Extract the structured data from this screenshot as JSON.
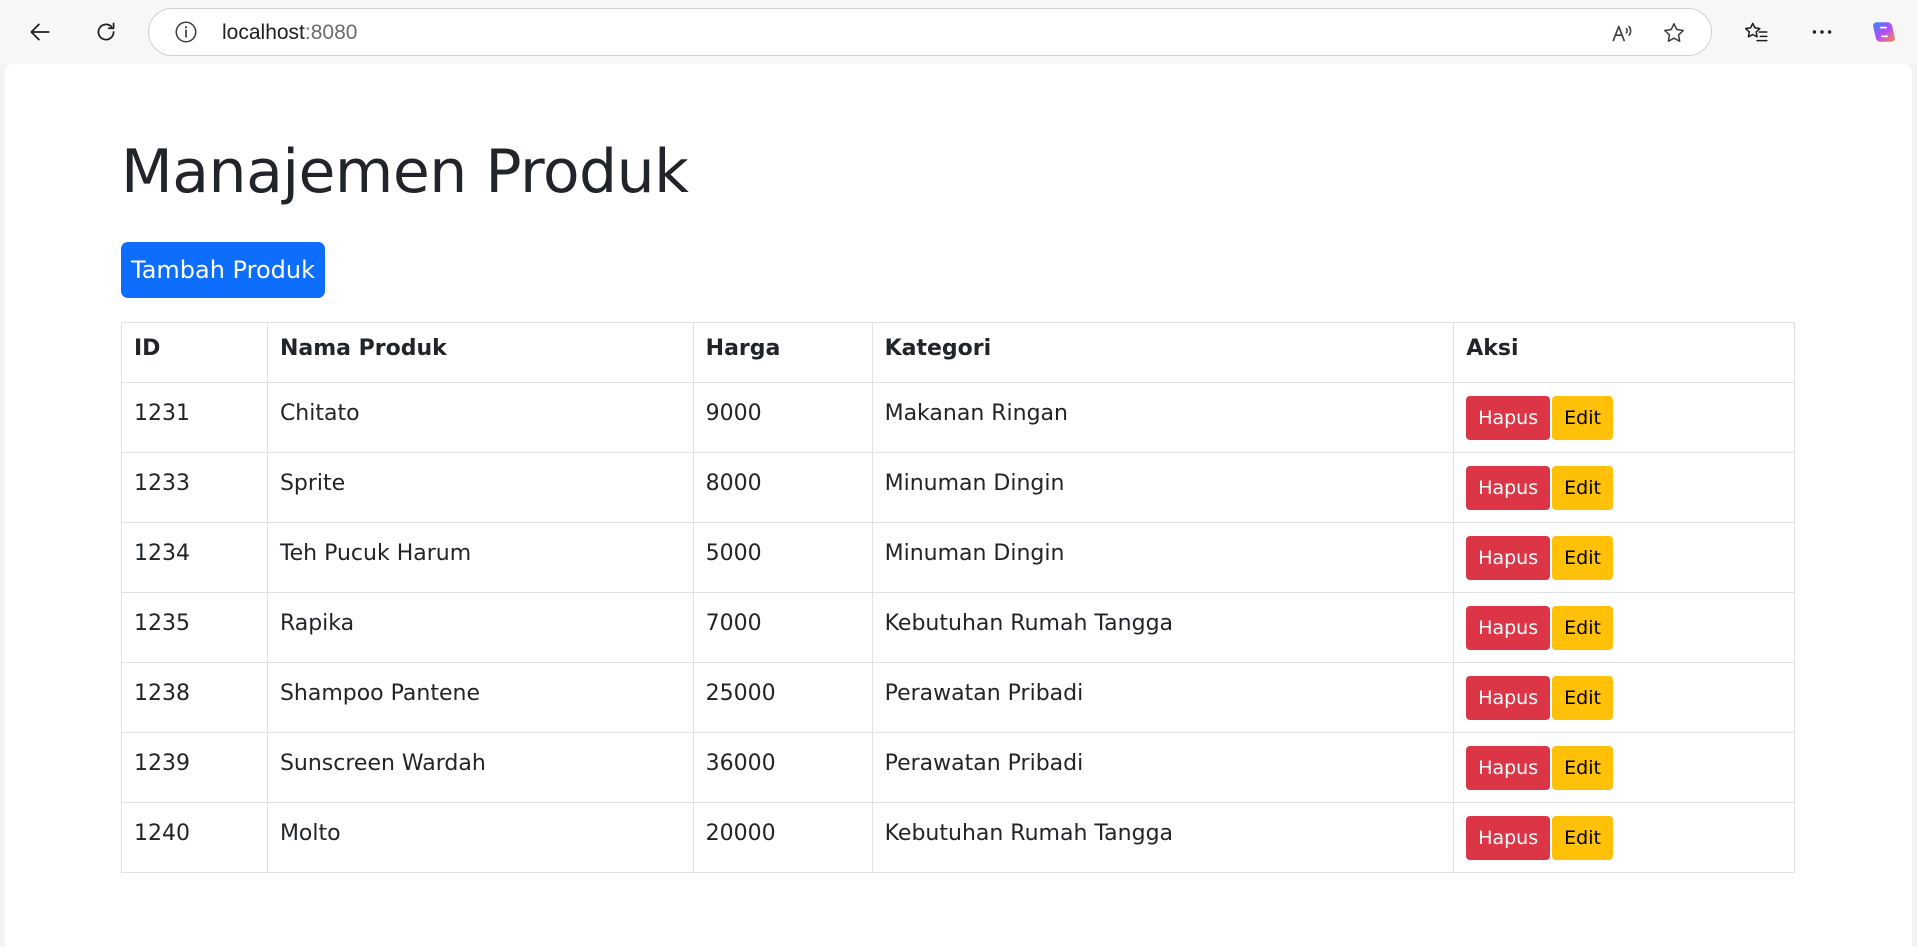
{
  "browser": {
    "url_host": "localhost",
    "url_port": ":8080"
  },
  "page": {
    "title": "Manajemen Produk",
    "add_button_label": "Tambah Produk"
  },
  "table": {
    "headers": {
      "id": "ID",
      "name": "Nama Produk",
      "price": "Harga",
      "category": "Kategori",
      "action": "Aksi"
    },
    "delete_label": "Hapus",
    "edit_label": "Edit",
    "rows": [
      {
        "id": "1231",
        "name": "Chitato",
        "price": "9000",
        "category": "Makanan Ringan"
      },
      {
        "id": "1233",
        "name": "Sprite",
        "price": "8000",
        "category": "Minuman Dingin"
      },
      {
        "id": "1234",
        "name": "Teh Pucuk Harum",
        "price": "5000",
        "category": "Minuman Dingin"
      },
      {
        "id": "1235",
        "name": "Rapika",
        "price": "7000",
        "category": "Kebutuhan Rumah Tangga"
      },
      {
        "id": "1238",
        "name": "Shampoo Pantene",
        "price": "25000",
        "category": "Perawatan Pribadi"
      },
      {
        "id": "1239",
        "name": "Sunscreen Wardah",
        "price": "36000",
        "category": "Perawatan Pribadi"
      },
      {
        "id": "1240",
        "name": "Molto",
        "price": "20000",
        "category": "Kebutuhan Rumah Tangga"
      }
    ]
  },
  "colors": {
    "primary": "#0d6efd",
    "danger": "#dc3545",
    "warning": "#ffc107"
  },
  "icons": [
    "back-arrow-icon",
    "refresh-icon",
    "info-icon",
    "read-aloud-icon",
    "favorite-star-icon",
    "favorites-list-icon",
    "more-icon",
    "copilot-icon"
  ]
}
